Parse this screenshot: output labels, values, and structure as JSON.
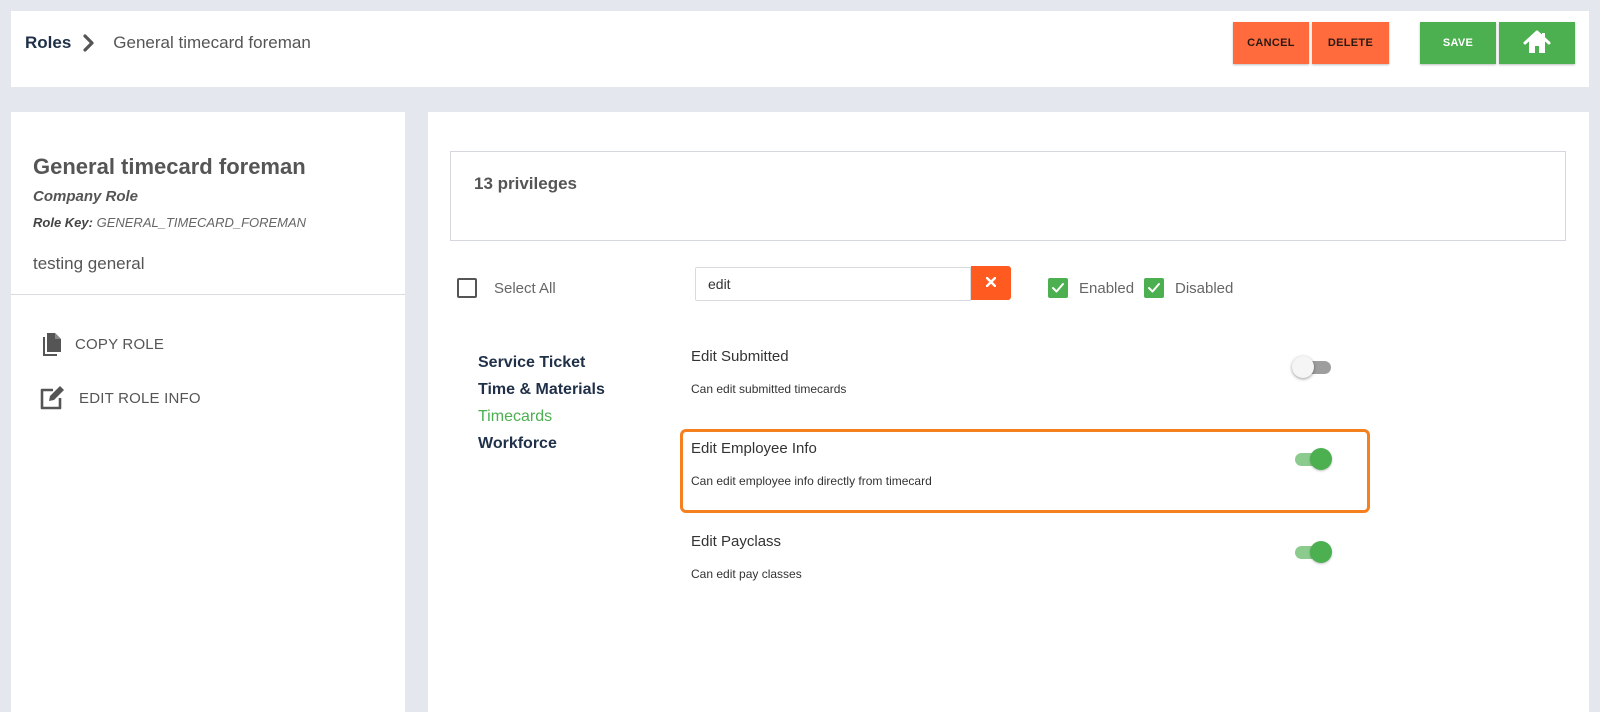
{
  "breadcrumb": {
    "root": "Roles",
    "current": "General timecard foreman"
  },
  "toolbar": {
    "cancel_label": "CANCEL",
    "delete_label": "DELETE",
    "save_label": "SAVE"
  },
  "colors": {
    "accent_orange": "#ff6b3d",
    "accent_green": "#4caf50",
    "highlight": "#f5801f",
    "navy": "#1f3048"
  },
  "role": {
    "title": "General timecard foreman",
    "type": "Company Role",
    "key_label": "Role Key:",
    "key_value": "GENERAL_TIMECARD_FOREMAN",
    "description": "testing general",
    "actions": [
      {
        "label": "COPY ROLE",
        "icon": "copy-icon"
      },
      {
        "label": "EDIT ROLE INFO",
        "icon": "edit-icon"
      }
    ]
  },
  "main": {
    "privilege_count": "13 privileges",
    "select_all_label": "Select All",
    "search": {
      "value": "edit",
      "placeholder": ""
    },
    "filters": [
      {
        "label": "Enabled",
        "checked": true
      },
      {
        "label": "Disabled",
        "checked": true
      }
    ],
    "categories": [
      {
        "label": "Service Ticket",
        "active": false
      },
      {
        "label": "Time & Materials",
        "active": false
      },
      {
        "label": "Timecards",
        "active": true
      },
      {
        "label": "Workforce",
        "active": false
      }
    ],
    "privileges": [
      {
        "name": "Edit Submitted",
        "description": "Can edit submitted timecards",
        "enabled": false
      },
      {
        "name": "Edit Employee Info",
        "description": "Can edit employee info directly from timecard",
        "enabled": true,
        "highlighted": true
      },
      {
        "name": "Edit Payclass",
        "description": "Can edit pay classes",
        "enabled": true
      }
    ]
  }
}
